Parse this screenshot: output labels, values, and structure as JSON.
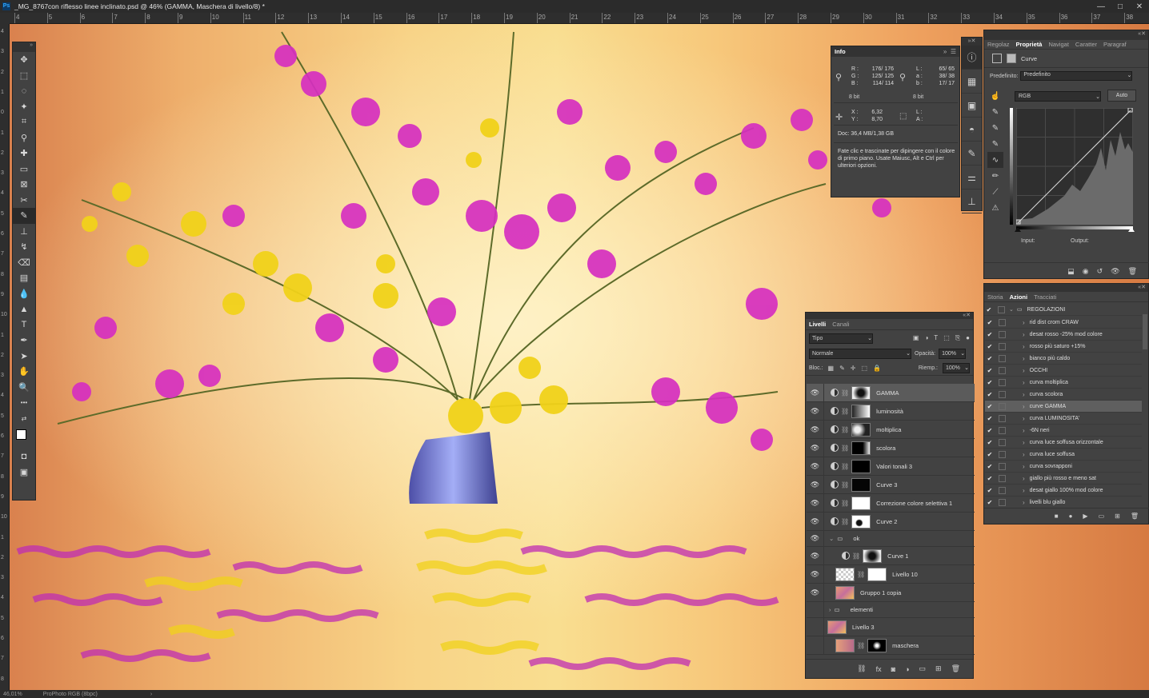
{
  "window": {
    "title": "_MG_8767con riflesso linee inclinato.psd @ 46% (GAMMA, Maschera di livello/8) *",
    "app_icon": "Ps",
    "controls": [
      "—",
      "□",
      "✕"
    ]
  },
  "ruler": {
    "h": [
      "4",
      "5",
      "6",
      "7",
      "8",
      "9",
      "10",
      "11",
      "12",
      "13",
      "14",
      "15",
      "16",
      "17",
      "18",
      "19",
      "20",
      "21",
      "22",
      "23",
      "24",
      "25",
      "26",
      "27",
      "28",
      "29",
      "30",
      "31",
      "32",
      "33",
      "34",
      "35",
      "36",
      "37",
      "38"
    ],
    "v": [
      "4",
      "3",
      "2",
      "1",
      "0",
      "1",
      "2",
      "3",
      "4",
      "5",
      "6",
      "7",
      "8",
      "9",
      "10",
      "1",
      "2",
      "3",
      "4",
      "5",
      "6",
      "7",
      "8",
      "9",
      "10",
      "1",
      "2",
      "3",
      "4",
      "5",
      "6",
      "7",
      "8"
    ]
  },
  "status": {
    "zoom": "46,01%",
    "profile": "ProPhoto RGB (8bpc)",
    "arrow": "›"
  },
  "tools": [
    "move-icon",
    "marquee-icon",
    "lasso-icon",
    "magic-wand-icon",
    "crop-icon",
    "eyedropper-icon",
    "healing-icon",
    "ruler-icon",
    "frame-icon",
    "patch-icon",
    "brush-icon",
    "stamp-icon",
    "history-brush-icon",
    "eraser-icon",
    "gradient-icon",
    "blur-icon",
    "dodge-icon",
    "type-icon",
    "pen-icon",
    "path-select-icon",
    "hand-icon",
    "zoom-icon",
    "more-icon",
    "swap-icon",
    "color-swatch-icon",
    "quickmask-icon",
    "screenmode-icon"
  ],
  "info": {
    "tab": "Info",
    "rgb": {
      "r": "R :",
      "g": "G :",
      "b": "B :",
      "rv": "176/ 176",
      "gv": "125/ 125",
      "bv": "114/ 114"
    },
    "lab": {
      "l": "L :",
      "a": "a :",
      "b": "b :",
      "lv": "65/ 65",
      "av": "38/ 38",
      "bv": "17/ 17"
    },
    "bits_left": "8 bit",
    "bits_right": "8 bit",
    "x": "X :",
    "y": "Y :",
    "xv": "6,32",
    "yv": "8,70",
    "w": "L :",
    "h": "A :",
    "doc": "Doc: 36,4 MB/1,38 GB",
    "hint": "Fate clic e trascinate per dipingere con il colore di primo piano. Usate Maiusc, Alt e Ctrl per ulteriori opzioni."
  },
  "props": {
    "tabs": [
      "Regolaz",
      "Proprietà",
      "Navigat",
      "Caratter",
      "Paragraf"
    ],
    "active_tab": 1,
    "title": "Curve",
    "preset_label": "Predefinito:",
    "preset_value": "Predefinito",
    "channel": "RGB",
    "auto": "Auto",
    "input_label": "Input:",
    "output_label": "Output:"
  },
  "layers": {
    "tabs": [
      "Livelli",
      "Canali"
    ],
    "filter": "Tipo",
    "blend": "Normale",
    "opacity_label": "Opacità:",
    "opacity": "100%",
    "lock_label": "Bloc.:",
    "fill_label": "Riemp.:",
    "fill": "100%",
    "rows": [
      {
        "name": "GAMMA"
      },
      {
        "name": "luminosità"
      },
      {
        "name": "moltiplica"
      },
      {
        "name": "scolora"
      },
      {
        "name": "Valori tonali 3"
      },
      {
        "name": "Curve 3"
      },
      {
        "name": "Correzione colore selettiva 1"
      },
      {
        "name": "Curve 2"
      },
      {
        "name": "ok"
      },
      {
        "name": "Curve 1"
      },
      {
        "name": "Livello 10"
      },
      {
        "name": "Gruppo 1 copia"
      },
      {
        "name": "elementi"
      },
      {
        "name": "Livello 3"
      },
      {
        "name": "maschera"
      }
    ]
  },
  "actions": {
    "tabs": [
      "Storia",
      "Azioni",
      "Tracciati"
    ],
    "active_tab": 1,
    "set": "REGOLAZIONI",
    "items": [
      "rid dist crom CRAW",
      "desat rosso -25% mod colore",
      "rosso più saturo +15%",
      "bianco più caldo",
      "OCCHI",
      "curva moltiplica",
      "curva scolora",
      "curve GAMMA",
      "curva LUMINOSITA'",
      "-6N neri",
      "curva luce soffusa orizzontale",
      "curva luce soffusa",
      "curva sovrapponi",
      "giallo più rosso e meno sat",
      "desat giallo 100% mod colore",
      "livelli blu giallo"
    ],
    "selected": 7
  },
  "colors": {
    "panel": "#424242",
    "dark": "#2f2f2f",
    "accent": "#31a8ff"
  }
}
